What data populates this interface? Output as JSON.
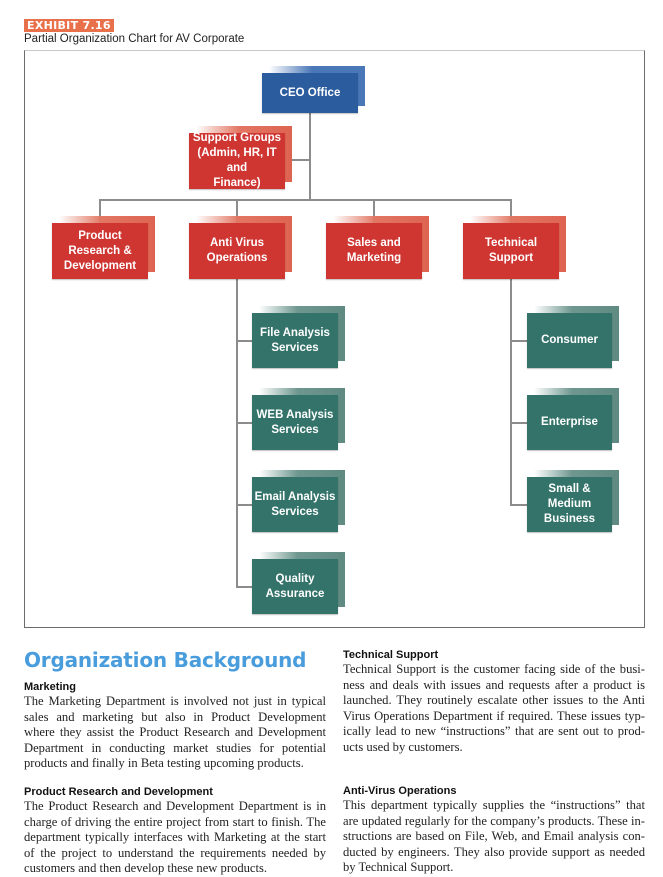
{
  "header": {
    "exhibit_label": "EXHIBIT 7.16",
    "exhibit_title": "Partial Organization Chart for AV Corporate"
  },
  "colors": {
    "exhibit_tag": "#e8704a",
    "ceo_box": "#2b5c9e",
    "department_box": "#cf3632",
    "team_box": "#33736a",
    "section_title": "#4a9ddc"
  },
  "org_chart": {
    "root": {
      "id": "ceo",
      "label": "CEO Office"
    },
    "staff": {
      "id": "support",
      "label": "Support Groups\n(Admin, HR, IT and\nFinance)",
      "reports_to": "ceo"
    },
    "departments": [
      {
        "id": "prd",
        "label": "Product\nResearch &\nDevelopment",
        "reports_to": "ceo"
      },
      {
        "id": "avo",
        "label": "Anti Virus\nOperations",
        "reports_to": "ceo"
      },
      {
        "id": "sales",
        "label": "Sales and\nMarketing",
        "reports_to": "ceo"
      },
      {
        "id": "tech",
        "label": "Technical\nSupport",
        "reports_to": "ceo"
      }
    ],
    "avo_teams": [
      {
        "label": "File Analysis\nServices",
        "reports_to": "avo"
      },
      {
        "label": "WEB Analysis\nServices",
        "reports_to": "avo"
      },
      {
        "label": "Email Analysis\nServices",
        "reports_to": "avo"
      },
      {
        "label": "Quality\nAssurance",
        "reports_to": "avo"
      }
    ],
    "tech_teams": [
      {
        "label": "Consumer",
        "reports_to": "tech"
      },
      {
        "label": "Enterprise",
        "reports_to": "tech"
      },
      {
        "label": "Small & Medium\nBusiness",
        "reports_to": "tech"
      }
    ]
  },
  "background": {
    "title": "Organization Background",
    "sections": [
      {
        "heading": "Marketing",
        "body": "The Marketing Department is involved not just in typi­cal sales and marketing but also in Product Development where they assist the Product Research and Development Department in conducting market studies for potential products and finally in Beta testing upcoming products."
      },
      {
        "heading": "Product Research and Development",
        "body": "The Product Research and Development Department is in charge of driving the entire project from start to finish. The department typically interfaces with Marketing at the start of the project to understand the requirements needed by customers and then develop these new products."
      },
      {
        "heading": "Technical Support",
        "body": "Technical Support is the customer facing side of the busi­ness and deals with issues and requests after a product is launched. They routinely escalate other issues to the Anti Virus Operations Department if required. These issues typ­ically lead to new “instructions” that are sent out to prod­ucts used by customers."
      },
      {
        "heading": "Anti-Virus Operations",
        "body": "This department typically supplies the “instructions” that are updated regularly for the company’s products. These in­structions are based on File, Web, and Email analysis con­ducted by engineers. They also provide support as needed by Technical Support."
      }
    ]
  }
}
